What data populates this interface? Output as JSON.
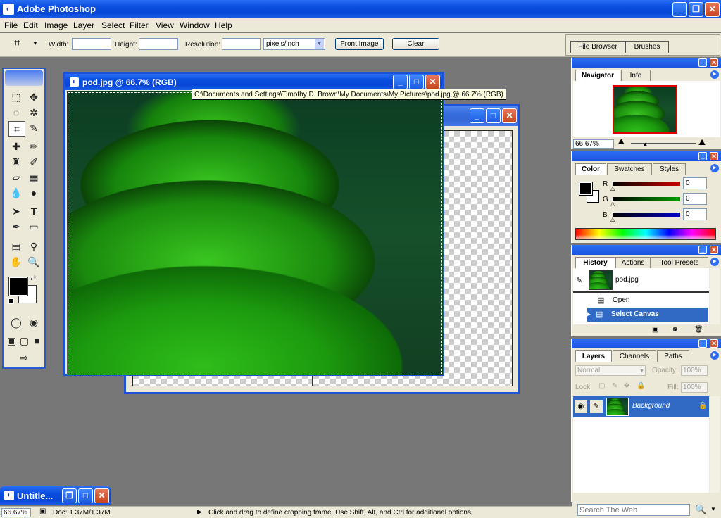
{
  "app": {
    "title": "Adobe Photoshop"
  },
  "menu": [
    "File",
    "Edit",
    "Image",
    "Layer",
    "Select",
    "Filter",
    "View",
    "Window",
    "Help"
  ],
  "options_bar": {
    "width_label": "Width:",
    "height_label": "Height:",
    "resolution_label": "Resolution:",
    "units_value": "pixels/inch",
    "front_image": "Front Image",
    "clear": "Clear",
    "well_tabs": [
      "File Browser",
      "Brushes"
    ]
  },
  "document": {
    "title": "pod.jpg @ 66.7% (RGB)",
    "tooltip": "C:\\Documents and Settings\\Timothy D. Brown\\My Documents\\My Pictures\\pod.jpg @ 66.7% (RGB)"
  },
  "minimized_doc": {
    "title": "Untitle..."
  },
  "navigator": {
    "tabs": [
      "Navigator",
      "Info"
    ],
    "zoom": "66.67%"
  },
  "color": {
    "tabs": [
      "Color",
      "Swatches",
      "Styles"
    ],
    "channels": [
      {
        "label": "R",
        "value": "0",
        "color": "#d00000"
      },
      {
        "label": "G",
        "value": "0",
        "color": "#00a000"
      },
      {
        "label": "B",
        "value": "0",
        "color": "#0000c8"
      }
    ]
  },
  "history": {
    "tabs": [
      "History",
      "Actions",
      "Tool Presets"
    ],
    "snapshot": "pod.jpg",
    "steps": [
      "Open",
      "Select Canvas"
    ]
  },
  "layers": {
    "tabs": [
      "Layers",
      "Channels",
      "Paths"
    ],
    "blend_mode": "Normal",
    "opacity_label": "Opacity:",
    "opacity": "100%",
    "lock_label": "Lock:",
    "fill_label": "Fill:",
    "fill": "100%",
    "layer_name": "Background"
  },
  "status": {
    "zoom": "66.67%",
    "doc": "Doc: 1.37M/1.37M",
    "hint": "Click and drag to define cropping frame. Use Shift, Alt, and Ctrl for additional options."
  },
  "search": {
    "placeholder": "Search The Web"
  },
  "colors": {
    "xp_blue": "#0a4fe0",
    "selection": "#316ac5",
    "panel": "#ece9d8"
  }
}
